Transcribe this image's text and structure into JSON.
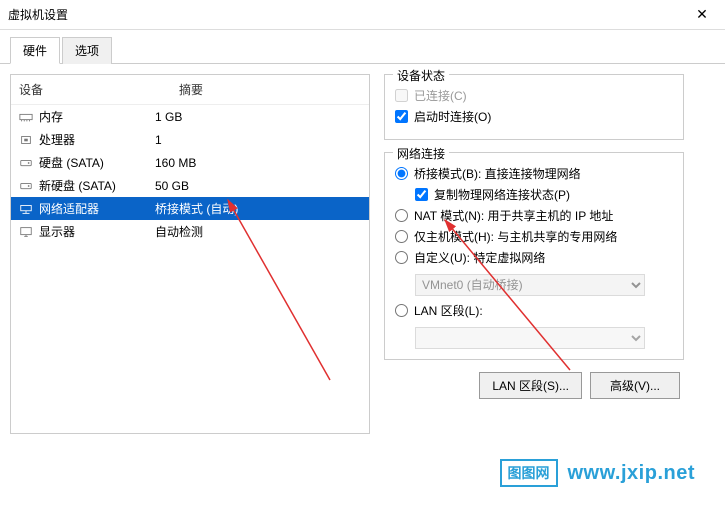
{
  "window": {
    "title": "虚拟机设置"
  },
  "tabs": [
    {
      "label": "硬件",
      "active": true
    },
    {
      "label": "选项",
      "active": false
    }
  ],
  "deviceList": {
    "headers": {
      "device": "设备",
      "summary": "摘要"
    },
    "rows": [
      {
        "icon": "memory-icon",
        "name": "内存",
        "summary": "1 GB",
        "selected": false
      },
      {
        "icon": "cpu-icon",
        "name": "处理器",
        "summary": "1",
        "selected": false
      },
      {
        "icon": "disk-icon",
        "name": "硬盘 (SATA)",
        "summary": "160 MB",
        "selected": false
      },
      {
        "icon": "disk-icon",
        "name": "新硬盘 (SATA)",
        "summary": "50 GB",
        "selected": false
      },
      {
        "icon": "network-icon",
        "name": "网络适配器",
        "summary": "桥接模式 (自动)",
        "selected": true
      },
      {
        "icon": "display-icon",
        "name": "显示器",
        "summary": "自动检测",
        "selected": false
      }
    ]
  },
  "status": {
    "legend": "设备状态",
    "connected": {
      "label": "已连接(C)",
      "checked": false,
      "disabled": true
    },
    "connectOnPower": {
      "label": "启动时连接(O)",
      "checked": true
    }
  },
  "network": {
    "legend": "网络连接",
    "bridge": {
      "label": "桥接模式(B): 直接连接物理网络",
      "checked": true
    },
    "replicate": {
      "label": "复制物理网络连接状态(P)",
      "checked": true
    },
    "nat": {
      "label": "NAT 模式(N): 用于共享主机的 IP 地址",
      "checked": false
    },
    "hostOnly": {
      "label": "仅主机模式(H): 与主机共享的专用网络",
      "checked": false
    },
    "custom": {
      "label": "自定义(U): 特定虚拟网络",
      "checked": false
    },
    "vmnet": {
      "value": "VMnet0 (自动桥接)"
    },
    "lanSegment": {
      "label": "LAN 区段(L):",
      "checked": false
    }
  },
  "buttons": {
    "lanSegments": "LAN 区段(S)...",
    "advanced": "高级(V)..."
  },
  "watermark": {
    "badge": "图图网",
    "url": "www.jxip.net"
  },
  "icons": {
    "memory-icon": "▭",
    "cpu-icon": "▣",
    "disk-icon": "⊟",
    "network-icon": "🖧",
    "display-icon": "🖵"
  }
}
